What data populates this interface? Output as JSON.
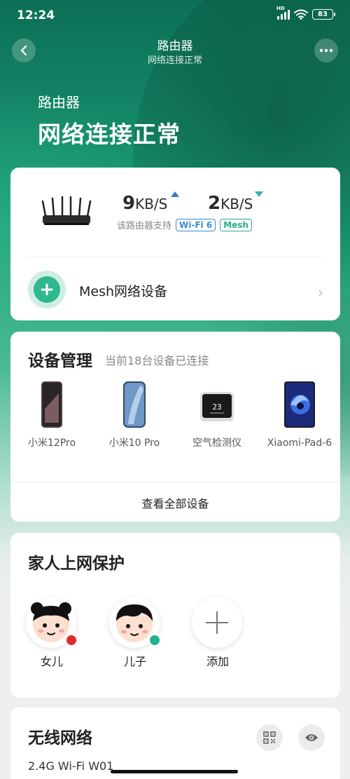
{
  "status_bar": {
    "time": "12:24",
    "battery": "83",
    "network_label": "HD"
  },
  "nav": {
    "title": "路由器",
    "subtitle": "网络连接正常"
  },
  "hero": {
    "title": "路由器",
    "status": "网络连接正常"
  },
  "router_card": {
    "upload": {
      "value": "9",
      "unit": "KB/S"
    },
    "download": {
      "value": "2",
      "unit": "KB/S"
    },
    "support_text": "该路由器支持",
    "tags": [
      "Wi-Fi 6",
      "Mesh"
    ],
    "mesh_label": "Mesh网络设备"
  },
  "devices": {
    "title": "设备管理",
    "subtitle": "当前18台设备已连接",
    "items": [
      {
        "name": "小米12Pro",
        "icon": "phone-icon"
      },
      {
        "name": "小米10 Pro",
        "icon": "phone-icon"
      },
      {
        "name": "空气检测仪",
        "icon": "air-monitor-icon",
        "display": "23"
      },
      {
        "name": "Xiaomi-Pad-6",
        "icon": "tablet-icon"
      }
    ],
    "view_all": "查看全部设备"
  },
  "family": {
    "title": "家人上网保护",
    "members": [
      {
        "name": "女儿",
        "status_color": "#e02b2b"
      },
      {
        "name": "儿子",
        "status_color": "#23b18e"
      }
    ],
    "add_label": "添加"
  },
  "wireless": {
    "title": "无线网络",
    "network_name": "2.4G Wi-Fi W01"
  },
  "colors": {
    "accent": "#2fb88f",
    "header_dark": "#0d6f55",
    "wifi_tag": "#3a8ad0",
    "mesh_tag": "#2aa88a"
  }
}
